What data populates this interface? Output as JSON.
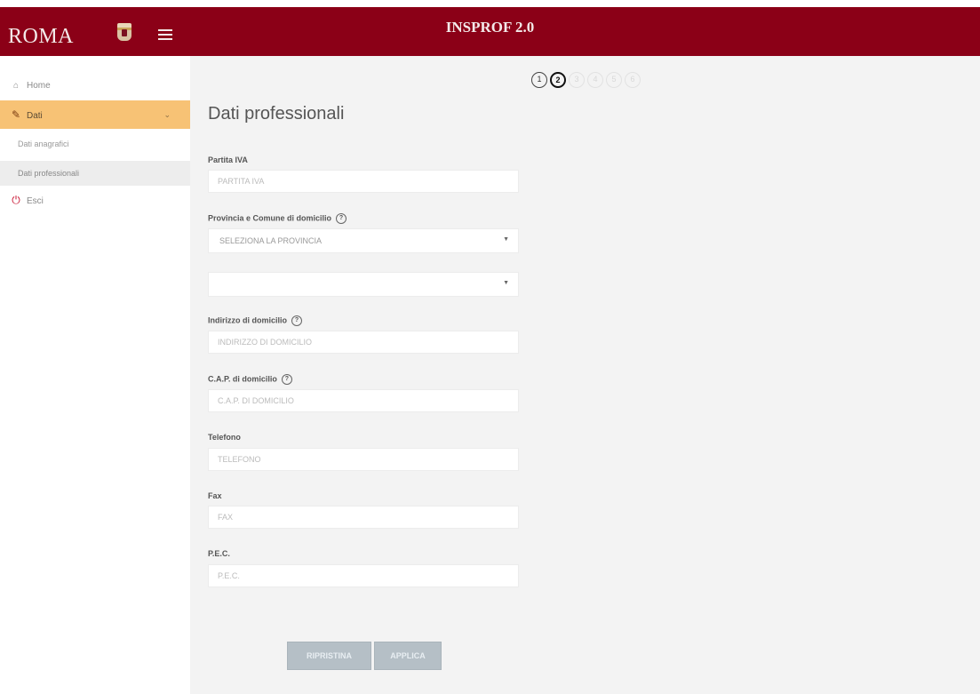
{
  "header": {
    "logo_text": "ROMA",
    "app_title": "INSPROF 2.0"
  },
  "sidebar": {
    "home": "Home",
    "dati": "Dati",
    "dati_sub": [
      "Dati anagrafici",
      "Dati professionali"
    ],
    "esci": "Esci"
  },
  "stepper": {
    "steps": [
      "1",
      "2",
      "3",
      "4",
      "5",
      "6"
    ],
    "current": 2
  },
  "form": {
    "title": "Dati professionali",
    "partita_iva": {
      "label": "Partita IVA",
      "placeholder": "PARTITA IVA"
    },
    "provincia": {
      "label": "Provincia e Comune di domicilio",
      "selected": "SELEZIONA LA PROVINCIA"
    },
    "comune": {
      "selected": ""
    },
    "indirizzo": {
      "label": "Indirizzo di domicilio",
      "placeholder": "INDIRIZZO DI DOMICILIO"
    },
    "cap": {
      "label": "C.A.P. di domicilio",
      "placeholder": "C.A.P. DI DOMICILIO"
    },
    "telefono": {
      "label": "Telefono",
      "placeholder": "TELEFONO"
    },
    "fax": {
      "label": "Fax",
      "placeholder": "FAX"
    },
    "pec": {
      "label": "P.E.C.",
      "placeholder": "P.E.C."
    },
    "buttons": {
      "reset": "RIPRISTINA",
      "apply": "APPLICA"
    }
  }
}
